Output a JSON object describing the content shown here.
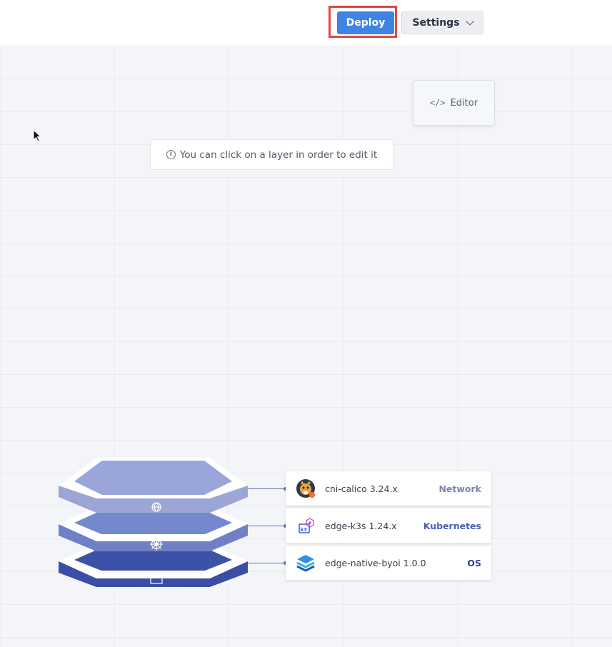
{
  "header": {
    "deploy_label": "Deploy",
    "settings_label": "Settings"
  },
  "editor": {
    "label": "Editor"
  },
  "hint": {
    "text": "You can click on a layer in order to edit it"
  },
  "layers": [
    {
      "name": "cni-calico 3.24.x",
      "type": "Network",
      "type_color": "#7c85b3",
      "icon": "calico-cat-icon"
    },
    {
      "name": "edge-k3s 1.24.x",
      "type": "Kubernetes",
      "type_color": "#4a5fb8",
      "icon": "k3s-icon"
    },
    {
      "name": "edge-native-byoi 1.0.0",
      "type": "OS",
      "type_color": "#2e3f9a",
      "icon": "layers-stack-icon"
    }
  ],
  "stack_icons": [
    "globe-icon",
    "helm-wheel-icon",
    "window-icon"
  ],
  "colors": {
    "deploy": "#3f84e5",
    "highlight": "#e5463c",
    "layer_top": "#9aa5d9",
    "layer_mid": "#6f80c8",
    "layer_bottom": "#3d51a8"
  }
}
